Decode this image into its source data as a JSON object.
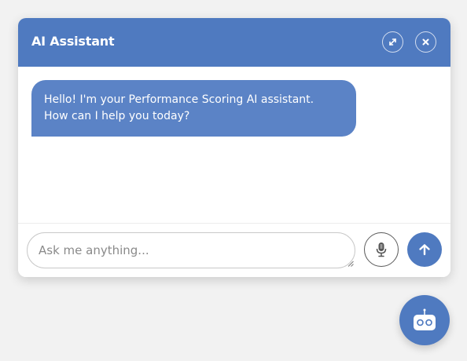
{
  "header": {
    "title": "AI Assistant",
    "expand_icon": "expand-icon",
    "close_icon": "close-icon"
  },
  "messages": [
    {
      "sender": "assistant",
      "lines": [
        "Hello! I'm your Performance Scoring AI assistant.",
        "How can I help you today?"
      ]
    }
  ],
  "composer": {
    "placeholder": "Ask me anything...",
    "value": "",
    "mic_icon": "microphone-icon",
    "send_icon": "arrow-up-icon"
  },
  "launcher": {
    "icon": "robot-icon"
  },
  "colors": {
    "accent": "#4f7ac0",
    "bubble": "#5b83c6",
    "background": "#f2f2f2"
  }
}
